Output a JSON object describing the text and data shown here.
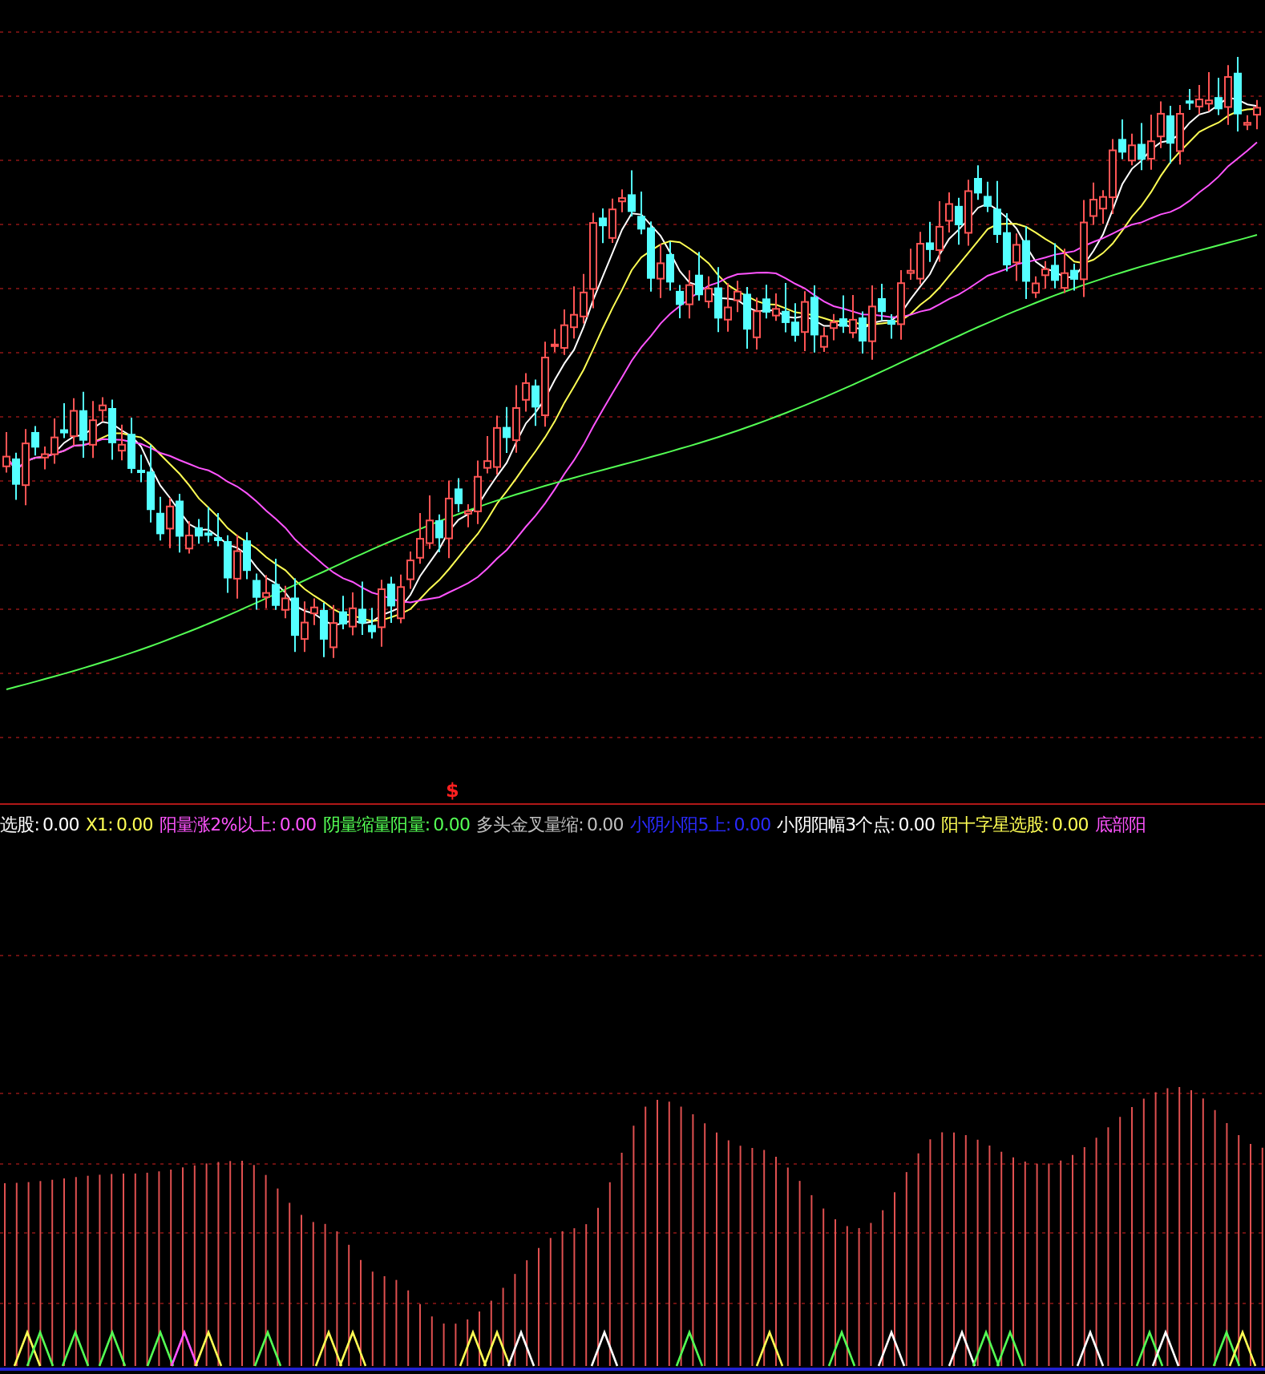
{
  "signal_marker": "$",
  "indicators": [
    {
      "label": "选股:",
      "value": "0.00",
      "color": "#ffffff"
    },
    {
      "label": "X1:",
      "value": "0.00",
      "color": "#ffff54"
    },
    {
      "label": "阳量涨2%以上:",
      "value": "0.00",
      "color": "#ff54ff"
    },
    {
      "label": "阴量缩量阳量:",
      "value": "0.00",
      "color": "#54ff54"
    },
    {
      "label": "多头金叉量缩:",
      "value": "0.00",
      "color": "#c0c0c0"
    },
    {
      "label": "小阴小阳5上:",
      "value": "0.00",
      "color": "#2a2aff"
    },
    {
      "label": "小阴阳幅3个点:",
      "value": "0.00",
      "color": "#ffffff"
    },
    {
      "label": "阳十字星选股:",
      "value": "0.00",
      "color": "#ffff54"
    },
    {
      "label": "底部阳",
      "color": "#ff54ff"
    }
  ]
}
